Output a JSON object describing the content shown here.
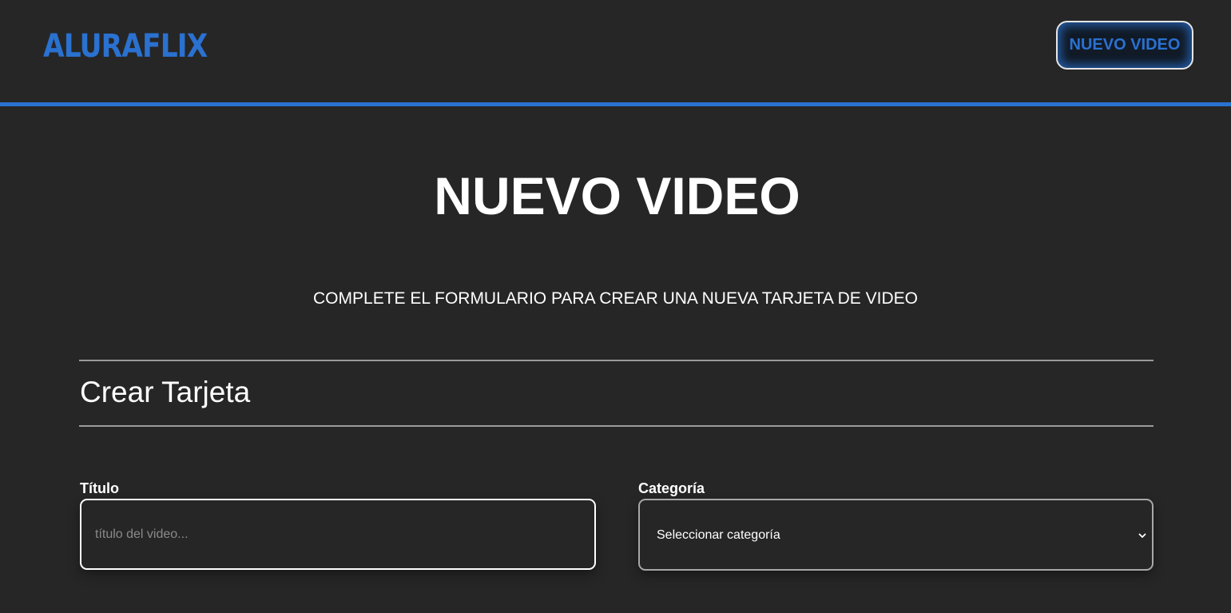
{
  "header": {
    "logo_text": "ALURAFLIX",
    "nav_button_label": "NUEVO VIDEO"
  },
  "main": {
    "title": "NUEVO VIDEO",
    "subtitle": "COMPLETE EL FORMULARIO PARA CREAR UNA NUEVA TARJETA DE VIDEO",
    "section_title": "Crear Tarjeta",
    "fields": {
      "titulo": {
        "label": "Título",
        "value": "",
        "placeholder": "título del video..."
      },
      "categoria": {
        "label": "Categoría",
        "selected": "Seleccionar categoría",
        "icon": "chevron-down-icon"
      }
    }
  },
  "colors": {
    "background": "#262626",
    "accent": "#2a71d0",
    "text": "#ffffff"
  }
}
